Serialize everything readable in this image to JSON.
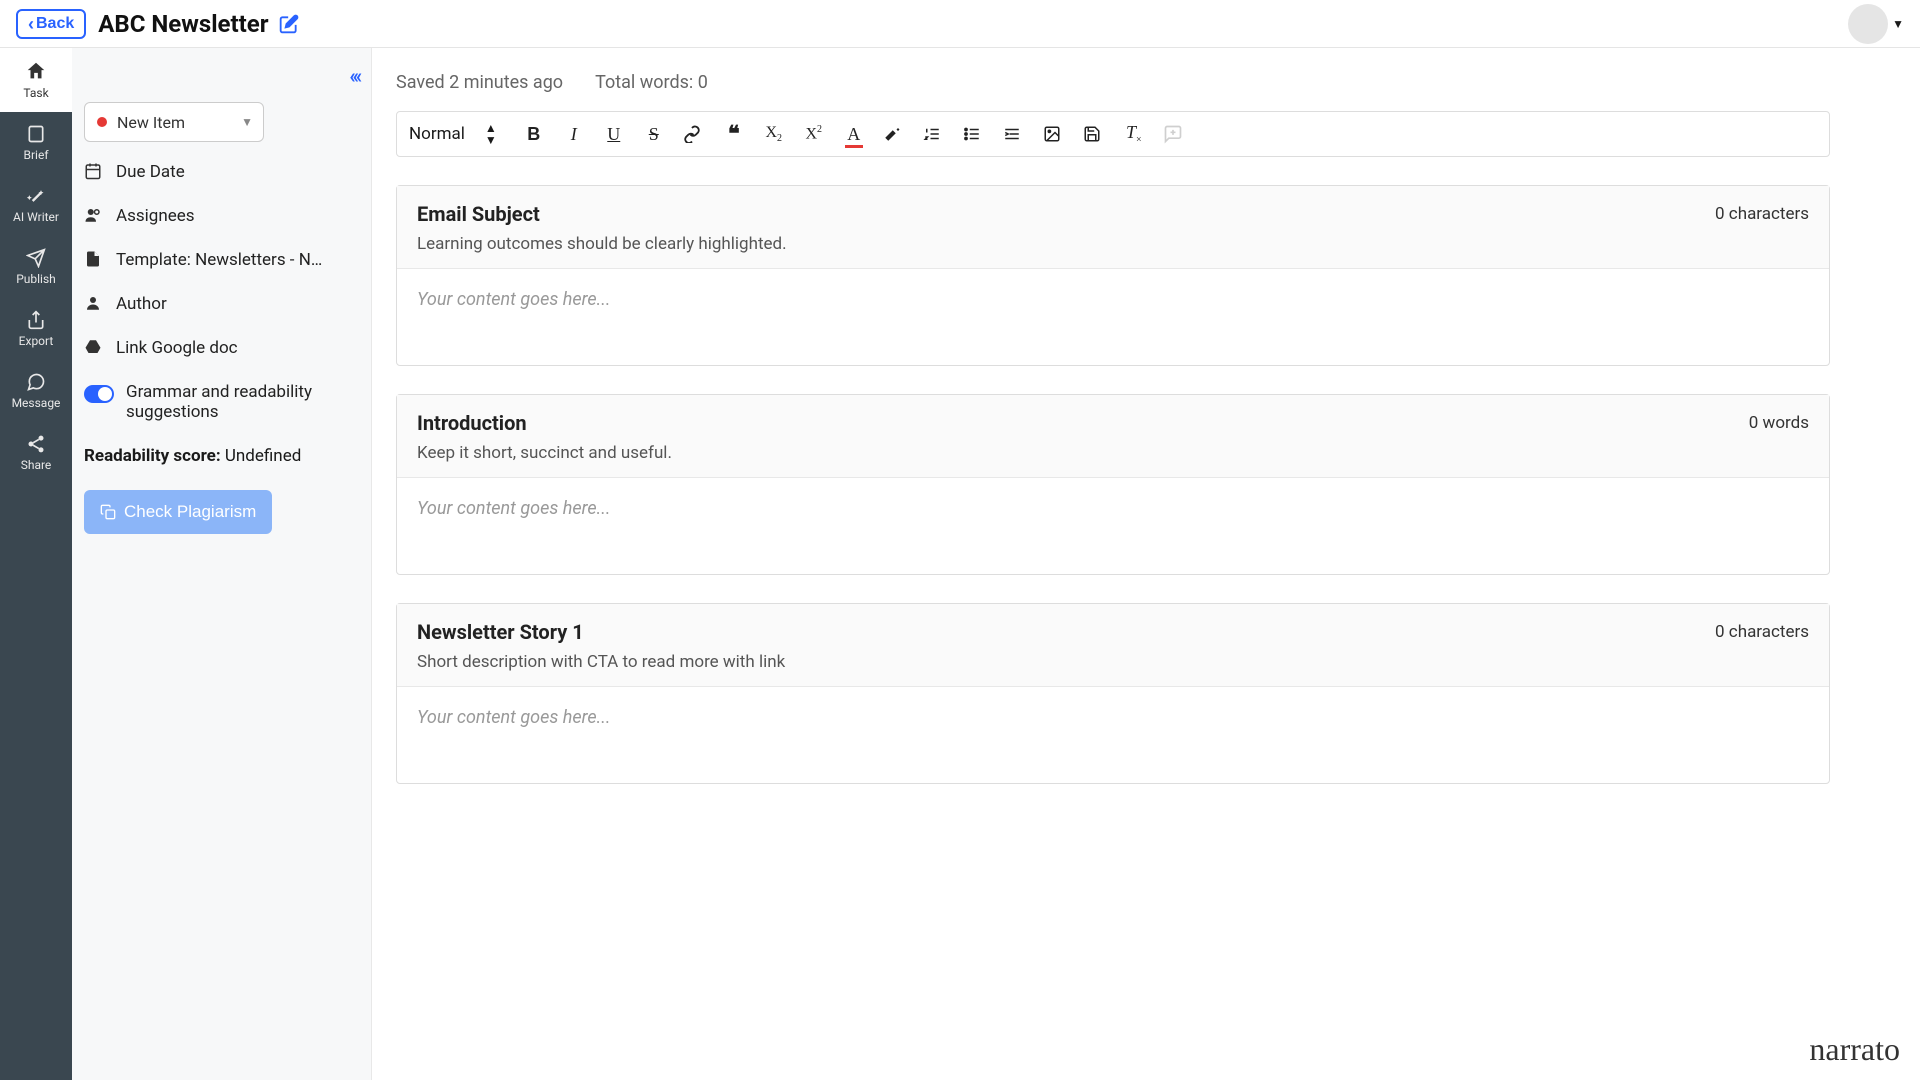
{
  "header": {
    "back_label": "Back",
    "title": "ABC Newsletter"
  },
  "nav": {
    "items": [
      {
        "label": "Task"
      },
      {
        "label": "Brief"
      },
      {
        "label": "AI Writer"
      },
      {
        "label": "Publish"
      },
      {
        "label": "Export"
      },
      {
        "label": "Message"
      },
      {
        "label": "Share"
      }
    ]
  },
  "side": {
    "status_label": "New Item",
    "status_color": "#e53935",
    "rows": {
      "due_date": "Due Date",
      "assignees": "Assignees",
      "template": "Template: Newsletters - New...",
      "author": "Author",
      "link_gdoc": "Link Google doc"
    },
    "grammar_toggle": "Grammar and readability suggestions",
    "readability_label": "Readability score:",
    "readability_value": "Undefined",
    "plagiarism_button": "Check Plagiarism"
  },
  "editor": {
    "saved_text": "Saved 2 minutes ago",
    "total_words_text": "Total words: 0",
    "format_label": "Normal",
    "placeholder": "Your content goes here...",
    "blocks": [
      {
        "title": "Email Subject",
        "count": "0 characters",
        "desc": "Learning outcomes should be clearly highlighted."
      },
      {
        "title": "Introduction",
        "count": "0 words",
        "desc": "Keep it short, succinct and useful."
      },
      {
        "title": "Newsletter Story 1",
        "count": "0 characters",
        "desc": "Short description with CTA to read more with link"
      }
    ]
  },
  "brand": "narrato"
}
